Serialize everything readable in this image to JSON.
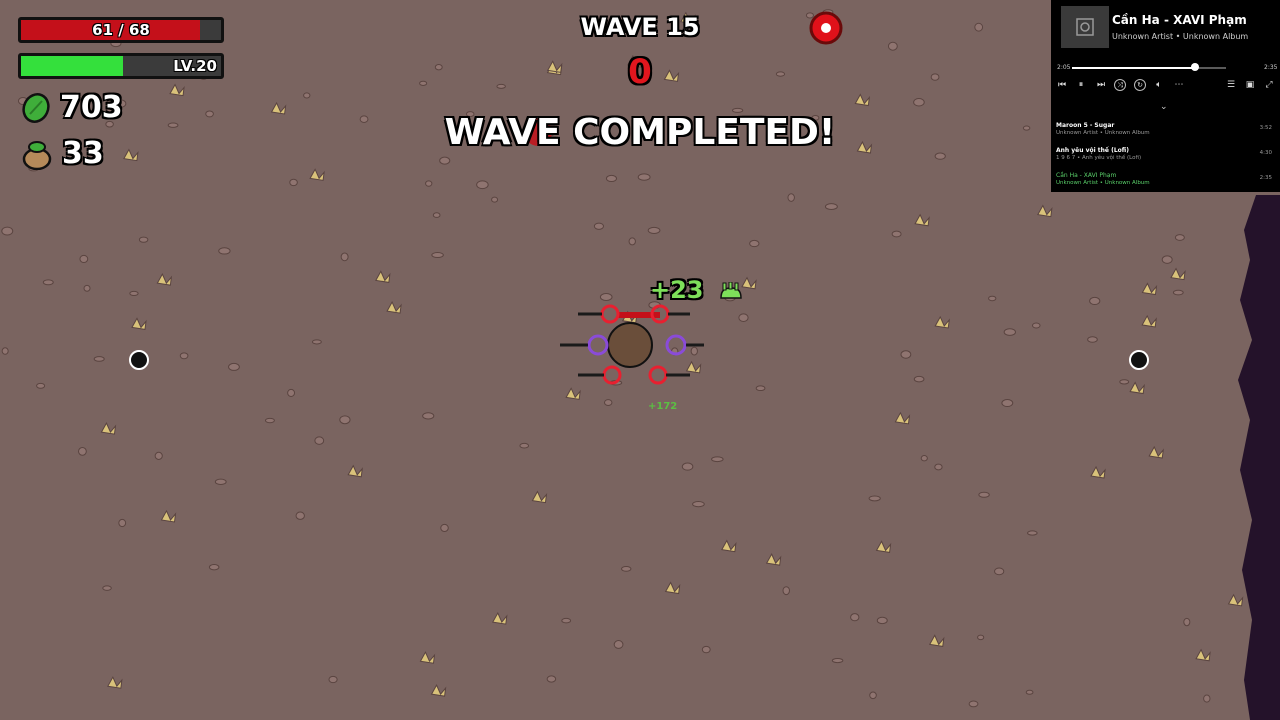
{
  "hud": {
    "hp_text": "61 / 68",
    "hp_fraction": 0.897,
    "level_text": "LV.20",
    "xp_fraction": 0.51,
    "materials": "703",
    "bag": "33",
    "colors": {
      "hp": "#c4101a",
      "xp": "#34e03c"
    }
  },
  "wave": {
    "title": "WAVE 15",
    "timer": "0",
    "status": "WAVE COMPLETED!"
  },
  "popups": {
    "xp_gain": "+23",
    "small": "+172"
  },
  "media_player": {
    "title": "Cần Ha - XAVI Phạm",
    "subtitle": "Unknown Artist • Unknown Album",
    "elapsed": "2:05",
    "duration": "2:35",
    "progress": 0.8,
    "queue": [
      {
        "title": "Maroon 5 - Sugar",
        "subtitle": "Unknown Artist • Unknown Album",
        "duration": "3:52",
        "active": false
      },
      {
        "title": "Anh yêu vội thế (Lofi)",
        "subtitle": "1 9 6 7 • Anh yêu vội thế (Lofi)",
        "duration": "4:30",
        "active": false
      },
      {
        "title": "Cần Ha - XAVI Phạm",
        "subtitle": "Unknown Artist • Unknown Album",
        "duration": "2:35",
        "active": true
      }
    ],
    "icons": [
      "album-art-icon",
      "previous-icon",
      "pause-icon",
      "next-icon",
      "shuffle-icon",
      "repeat-icon",
      "volume-icon",
      "more-icon",
      "queue-icon",
      "miniplayer-icon",
      "expand-icon",
      "chevron-down-icon"
    ]
  }
}
